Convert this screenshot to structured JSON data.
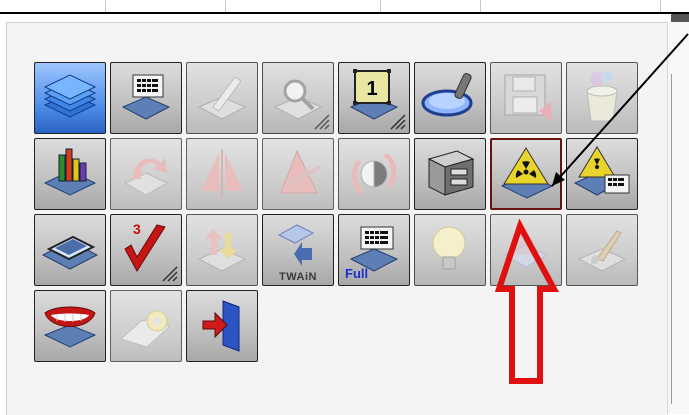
{
  "toolbar": {
    "tiles": [
      {
        "name": "stack-pages-icon",
        "label": ""
      },
      {
        "name": "keyboard-scan-icon",
        "label": ""
      },
      {
        "name": "pencil-edit-icon",
        "label": ""
      },
      {
        "name": "zoom-page-icon",
        "label": ""
      },
      {
        "name": "page-number-icon",
        "label": "1"
      },
      {
        "name": "magnifier-icon",
        "label": ""
      },
      {
        "name": "save-disk-icon",
        "label": ""
      },
      {
        "name": "recycle-bin-icon",
        "label": ""
      },
      {
        "name": "chart-icon",
        "label": ""
      },
      {
        "name": "rotate-icon",
        "label": ""
      },
      {
        "name": "mirror-icon",
        "label": ""
      },
      {
        "name": "ruler-triangle-icon",
        "label": ""
      },
      {
        "name": "flip-rotate-icon",
        "label": ""
      },
      {
        "name": "scanner-drawer-icon",
        "label": ""
      },
      {
        "name": "radiation-page-icon",
        "label": ""
      },
      {
        "name": "radiation-keyboard-icon",
        "label": ""
      },
      {
        "name": "film-icon",
        "label": ""
      },
      {
        "name": "checkmark-three-icon",
        "label": "3"
      },
      {
        "name": "swap-arrows-icon",
        "label": ""
      },
      {
        "name": "twain-source-icon",
        "label": "TWAiN"
      },
      {
        "name": "full-keyboard-icon",
        "label": "Full"
      },
      {
        "name": "lightbulb-icon",
        "label": ""
      },
      {
        "name": "blank-page-icon",
        "label": ""
      },
      {
        "name": "brush-icon",
        "label": ""
      },
      {
        "name": "smile-mouth-icon",
        "label": ""
      },
      {
        "name": "settings-gear-icon",
        "label": ""
      },
      {
        "name": "exit-door-icon",
        "label": ""
      }
    ]
  }
}
